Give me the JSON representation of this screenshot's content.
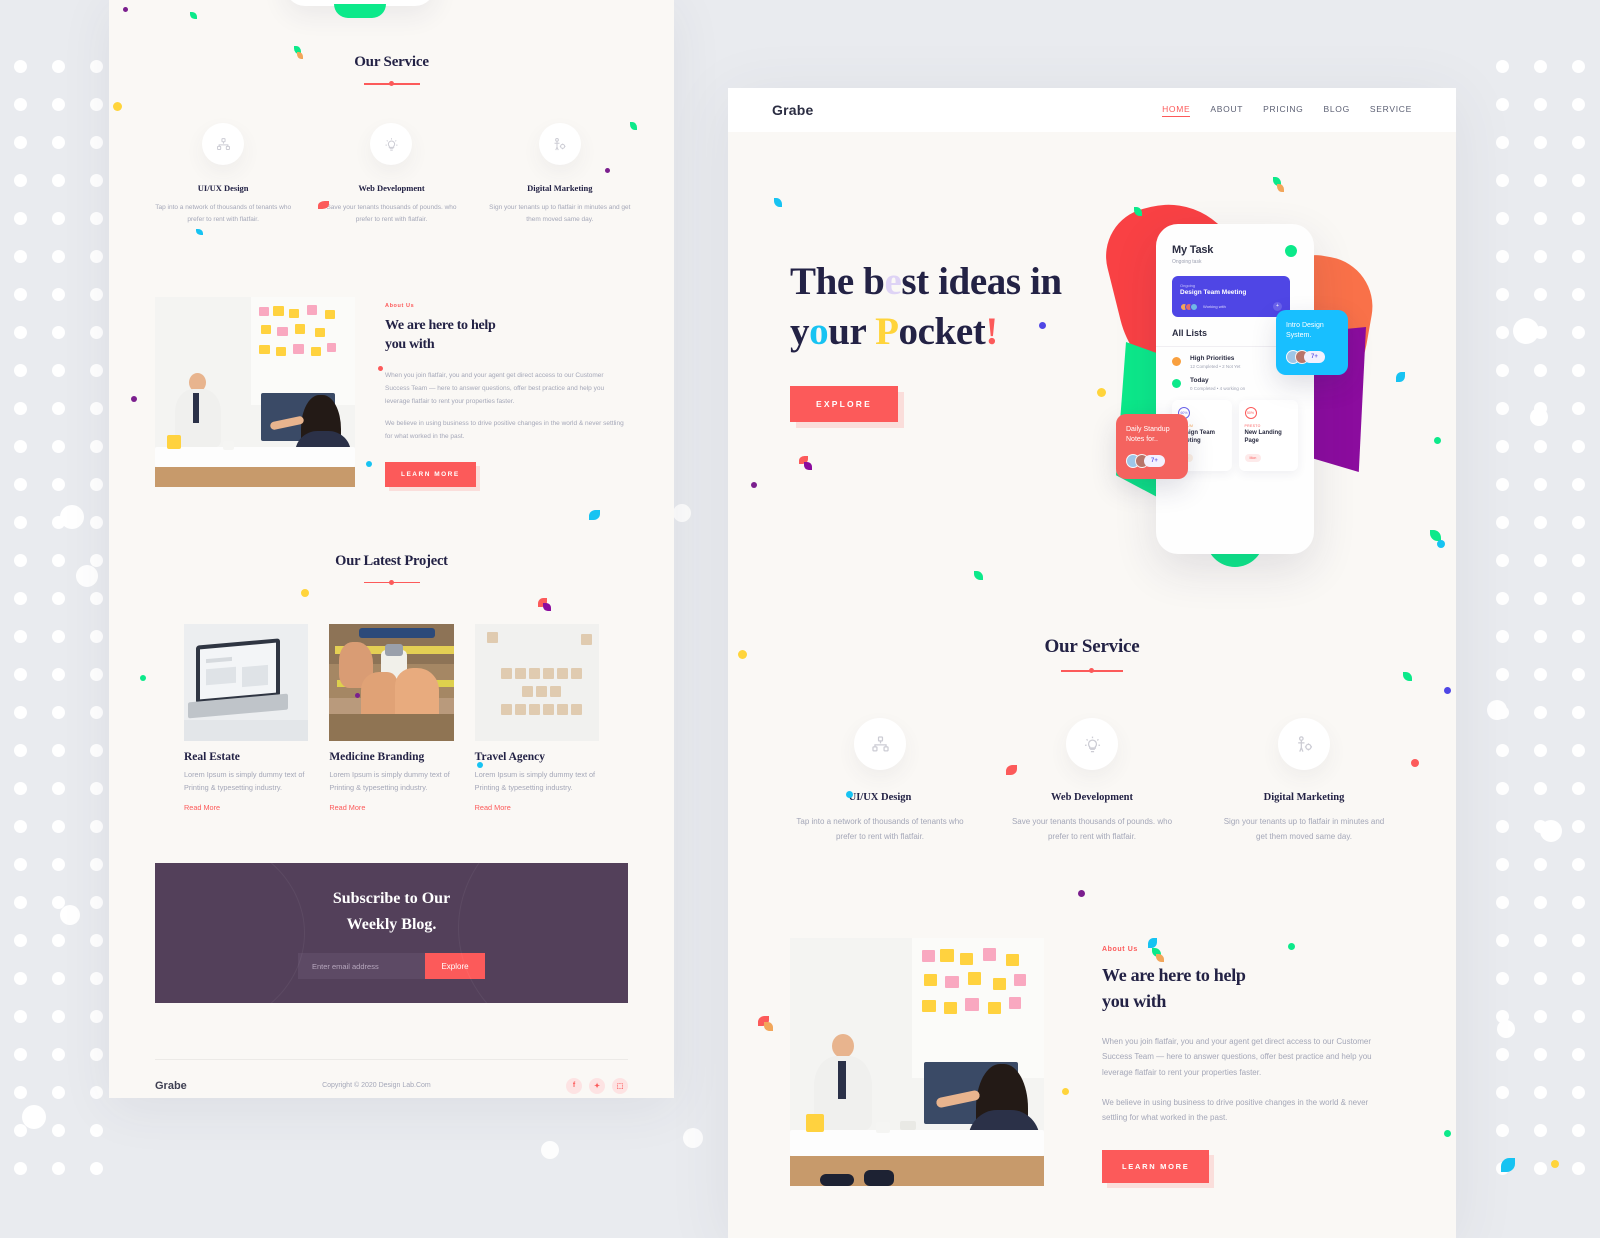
{
  "nav": {
    "logo": "Grabe",
    "links": [
      {
        "label": "HOME",
        "active": true
      },
      {
        "label": "ABOUT",
        "active": false
      },
      {
        "label": "PRICING",
        "active": false
      },
      {
        "label": "BLOG",
        "active": false
      },
      {
        "label": "SERVICE",
        "active": false
      }
    ]
  },
  "hero": {
    "line1_a": "The b",
    "line1_e": "e",
    "line1_b": "st id",
    "line1_dot": "e",
    "line1_c": "as in",
    "line2_a": "y",
    "line2_o": "o",
    "line2_b": "ur ",
    "line2_p": "P",
    "line2_c": "ocket",
    "line2_bang": "!",
    "full_title": "The best ideas in your Pocket!",
    "cta": "EXPLORE"
  },
  "phone": {
    "title": "My Task",
    "subtitle": "Ongoing task",
    "card": {
      "tag": "Ongoing",
      "name": "Design Team Meeting",
      "working_with": "Working with",
      "plus": "+"
    },
    "all_lists": "All Lists",
    "lists": [
      {
        "name": "High Priorities",
        "meta": "12 Completed  •  2 Not Yet"
      },
      {
        "name": "Today",
        "meta": "0 Completed  •  4 working on"
      }
    ],
    "tiles": [
      {
        "pct": "60%",
        "brand": "FITGUM",
        "name": "Design Team Meeting",
        "day": "Sat"
      },
      {
        "pct": "50%",
        "brand": "PRESTO",
        "name": "New Landing Page",
        "day": "Mon"
      }
    ],
    "float_cyan": {
      "text": "Intro Design System.",
      "more": "7+"
    },
    "float_red": {
      "text": "Daily Standup Notes for..",
      "more": "7+"
    }
  },
  "service": {
    "title": "Our Service",
    "items": [
      {
        "icon": "sitemap-icon",
        "name": "UI/UX Design",
        "desc": "Tap into a network of thousands of tenants who prefer to rent with flatfair."
      },
      {
        "icon": "lightbulb-icon",
        "name": "Web Development",
        "desc": "Save your tenants thousands of pounds. who prefer to rent with flatfair."
      },
      {
        "icon": "person-gear-icon",
        "name": "Digital Marketing",
        "desc": "Sign your tenants up to flatfair in minutes and get them moved same day."
      }
    ]
  },
  "about": {
    "label": "About Us",
    "title_l1": "We are here to help",
    "title_l2": "you with",
    "p1": "When you join flatfair, you and your agent get direct access to our Customer Success Team — here to answer questions, offer best practice and help you leverage flatfair to rent your properties faster.",
    "p2": "We believe in using business to drive positive changes in the world & never settling for what worked in the past.",
    "cta": "LEARN MORE"
  },
  "projects": {
    "title": "Our Latest Project",
    "items": [
      {
        "name": "Real Estate",
        "desc": "Lorem Ipsum is simply dummy text of Printing & typesetting industry.",
        "link": "Read More"
      },
      {
        "name": "Medicine Branding",
        "desc": "Lorem Ipsum is simply dummy text of Printing & typesetting industry.",
        "link": "Read More"
      },
      {
        "name": "Travel Agency",
        "desc": "Lorem Ipsum is simply dummy text of Printing & typesetting industry.",
        "link": "Read More"
      }
    ]
  },
  "subscribe": {
    "title_l1": "Subscribe to Our",
    "title_l2": "Weekly Blog.",
    "placeholder": "Enter email address",
    "button": "Explore"
  },
  "footer": {
    "logo": "Grabe",
    "copyright": "Copyright © 2020 Design Lab.Com",
    "socials": [
      {
        "icon": "facebook-icon",
        "glyph": "f"
      },
      {
        "icon": "twitter-icon",
        "glyph": "✦"
      },
      {
        "icon": "instagram-icon",
        "glyph": "⬚"
      }
    ]
  },
  "colors": {
    "accent": "#fc5a5a",
    "dark": "#232245",
    "muted": "#a4a7b8",
    "panel_bg": "#faf8f5",
    "page_bg": "#e9ebef",
    "subscribe_bg": "#53405a",
    "cyan": "#18bfff",
    "green": "#0ce98a",
    "purple": "#8b0c9e",
    "orange": "#f97149",
    "indigo": "#4f46e5"
  }
}
